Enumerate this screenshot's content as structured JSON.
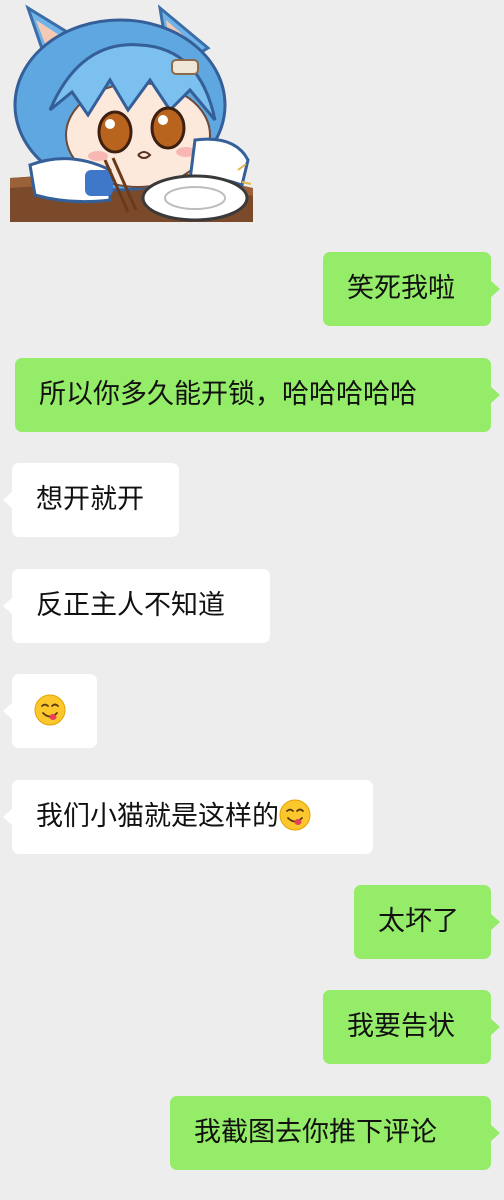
{
  "chat": {
    "sticker": {
      "description_icon": "cat-boy-sticker"
    },
    "messages": [
      {
        "id": "m1",
        "side": "out",
        "text": "笑死我啦"
      },
      {
        "id": "m2",
        "side": "out",
        "text": "所以你多久能开锁，哈哈哈哈哈"
      },
      {
        "id": "m3",
        "side": "in",
        "text": "想开就开"
      },
      {
        "id": "m4",
        "side": "in",
        "text": "反正主人不知道"
      },
      {
        "id": "m5",
        "side": "in",
        "text": "",
        "emoji": "yum-face-emoji"
      },
      {
        "id": "m6",
        "side": "in",
        "text": "我们小猫就是这样的",
        "emoji": "yum-face-emoji"
      },
      {
        "id": "m7",
        "side": "out",
        "text": "太坏了"
      },
      {
        "id": "m8",
        "side": "out",
        "text": "我要告状"
      },
      {
        "id": "m9",
        "side": "out",
        "text": "我截图去你推下评论"
      }
    ]
  },
  "colors": {
    "background": "#ededed",
    "outgoing_bubble": "#95ec69",
    "incoming_bubble": "#ffffff",
    "text": "#111111"
  }
}
